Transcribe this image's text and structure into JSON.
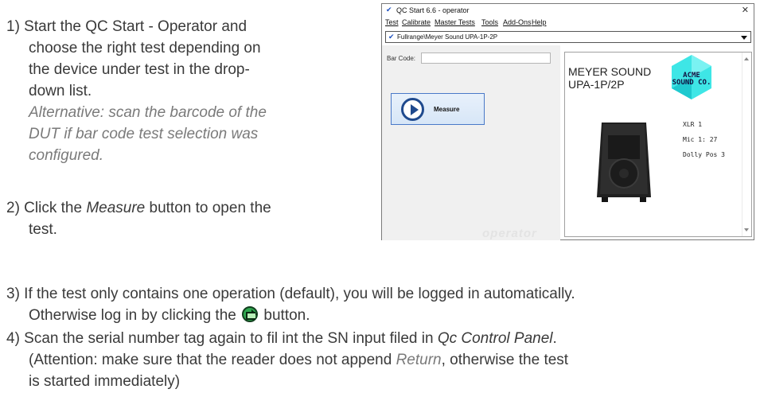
{
  "step1": {
    "line1": "1) Start the QC Start - Operator and",
    "line2": "choose the right test depending on",
    "line3": "the device under test in the drop-",
    "line4": "down list.",
    "alt1": "Alternative: scan the barcode of the",
    "alt2": "DUT if bar code test selection was",
    "alt3": "configured."
  },
  "step2": {
    "prefix": "2) Click the ",
    "emph": "Measure",
    "suffix": " button to open the",
    "line2": "test."
  },
  "step3": {
    "line1": "3) If the test only contains one operation (default), you will be logged in automatically.",
    "line2_prefix": "Otherwise log in by clicking the ",
    "line2_suffix": " button.",
    "icon": "green-arrow-login-icon"
  },
  "step4": {
    "line1_prefix": "4) Scan the serial number tag again to fil int the SN input filed in ",
    "line1_emph": "Qc Control Panel",
    "line1_suffix": ".",
    "line2_prefix": "(Attention: make sure that the reader does not append ",
    "line2_emph": "Return",
    "line2_suffix": ", otherwise the test",
    "line3": "is started immediately)"
  },
  "app": {
    "title": "QC Start  6.6 - operator",
    "menu": [
      "Test",
      "Calibrate",
      "Master Tests",
      "Tools",
      "Add-Ons",
      "Help"
    ],
    "selected_test": "Fullrange\\Meyer Sound UPA-1P-2P",
    "barcode_label": "Bar Code:",
    "barcode_value": "",
    "measure_label": "Measure",
    "watermark": "operator",
    "device_title": "MEYER SOUND\nUPA-1P/2P",
    "logo_line1": "ACME",
    "logo_line2": "SOUND CO.",
    "info": [
      "XLR 1",
      "Mic 1: 27",
      "Dolly Pos 3"
    ],
    "colors": {
      "logo_cyan": "#3ee6e6",
      "button_border": "#4a79c8",
      "play_blue": "#1f4a8e"
    }
  }
}
